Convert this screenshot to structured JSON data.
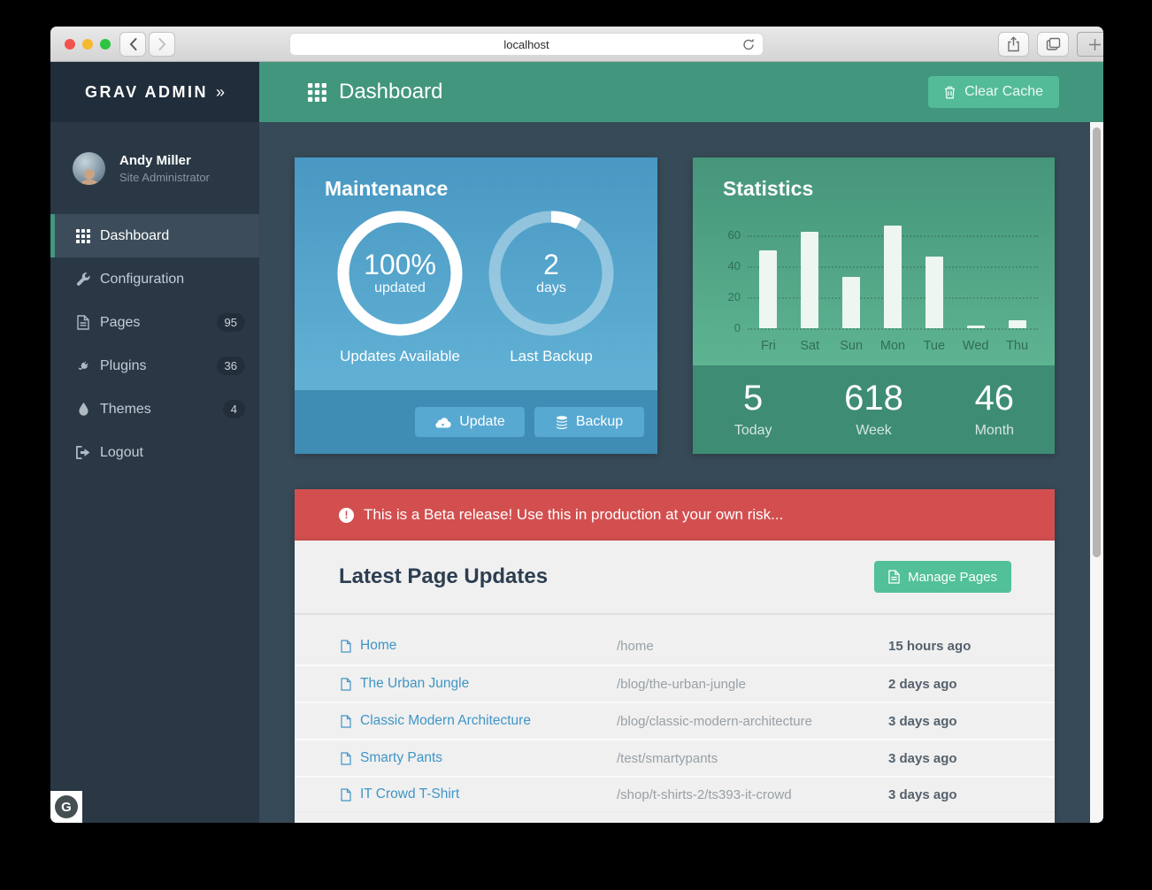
{
  "browser": {
    "url": "localhost"
  },
  "sidebar": {
    "brand": "GRAV ADMIN",
    "brand_chevrons": "»",
    "user": {
      "name": "Andy Miller",
      "role": "Site Administrator"
    },
    "items": [
      {
        "label": "Dashboard"
      },
      {
        "label": "Configuration"
      },
      {
        "label": "Pages",
        "badge": "95"
      },
      {
        "label": "Plugins",
        "badge": "36"
      },
      {
        "label": "Themes",
        "badge": "4"
      },
      {
        "label": "Logout"
      }
    ]
  },
  "header": {
    "title": "Dashboard",
    "clear_cache": "Clear Cache"
  },
  "maintenance": {
    "title": "Maintenance",
    "updates_value": "100%",
    "updates_unit": "updated",
    "updates_label": "Updates Available",
    "updates_percent": 100,
    "backup_value": "2",
    "backup_unit": "days",
    "backup_label": "Last Backup",
    "backup_percent": 8,
    "update_button": "Update",
    "backup_button": "Backup"
  },
  "statistics": {
    "title": "Statistics",
    "totals": [
      {
        "value": "5",
        "label": "Today"
      },
      {
        "value": "618",
        "label": "Week"
      },
      {
        "value": "46",
        "label": "Month"
      }
    ]
  },
  "chart_data": {
    "type": "bar",
    "categories": [
      "Fri",
      "Sat",
      "Sun",
      "Mon",
      "Tue",
      "Wed",
      "Thu"
    ],
    "values": [
      50,
      62,
      33,
      66,
      46,
      2,
      5
    ],
    "title": "Statistics",
    "xlabel": "",
    "ylabel": "",
    "ylim": [
      0,
      70
    ],
    "yticks": [
      0,
      20,
      40,
      60
    ],
    "grid": "dotted-horizontal",
    "legend": "none",
    "bar_color": "#edf6f1"
  },
  "alert": {
    "text": "This is a Beta release! Use this in production at your own risk..."
  },
  "pages_panel": {
    "title": "Latest Page Updates",
    "manage_button": "Manage Pages",
    "rows": [
      {
        "title": "Home",
        "path": "/home",
        "time": "15 hours ago"
      },
      {
        "title": "The Urban Jungle",
        "path": "/blog/the-urban-jungle",
        "time": "2 days ago"
      },
      {
        "title": "Classic Modern Architecture",
        "path": "/blog/classic-modern-architecture",
        "time": "3 days ago"
      },
      {
        "title": "Smarty Pants",
        "path": "/test/smartypants",
        "time": "3 days ago"
      },
      {
        "title": "IT Crowd T-Shirt",
        "path": "/shop/t-shirts-2/ts393-it-crowd",
        "time": "3 days ago"
      }
    ]
  },
  "logo": {
    "letter": "G"
  },
  "colors": {
    "accent_teal": "#42967d",
    "button_green": "#53bb97",
    "maintenance_blue_top": "#4898c3",
    "maintenance_footer": "#3f8cb4",
    "statistics_green_top": "#45957a",
    "statistics_footer": "#3e8c74",
    "alert_red": "#d34f4f",
    "link_blue": "#4095c6",
    "sidebar_bg": "#2a3845",
    "main_bg": "#374a57"
  }
}
